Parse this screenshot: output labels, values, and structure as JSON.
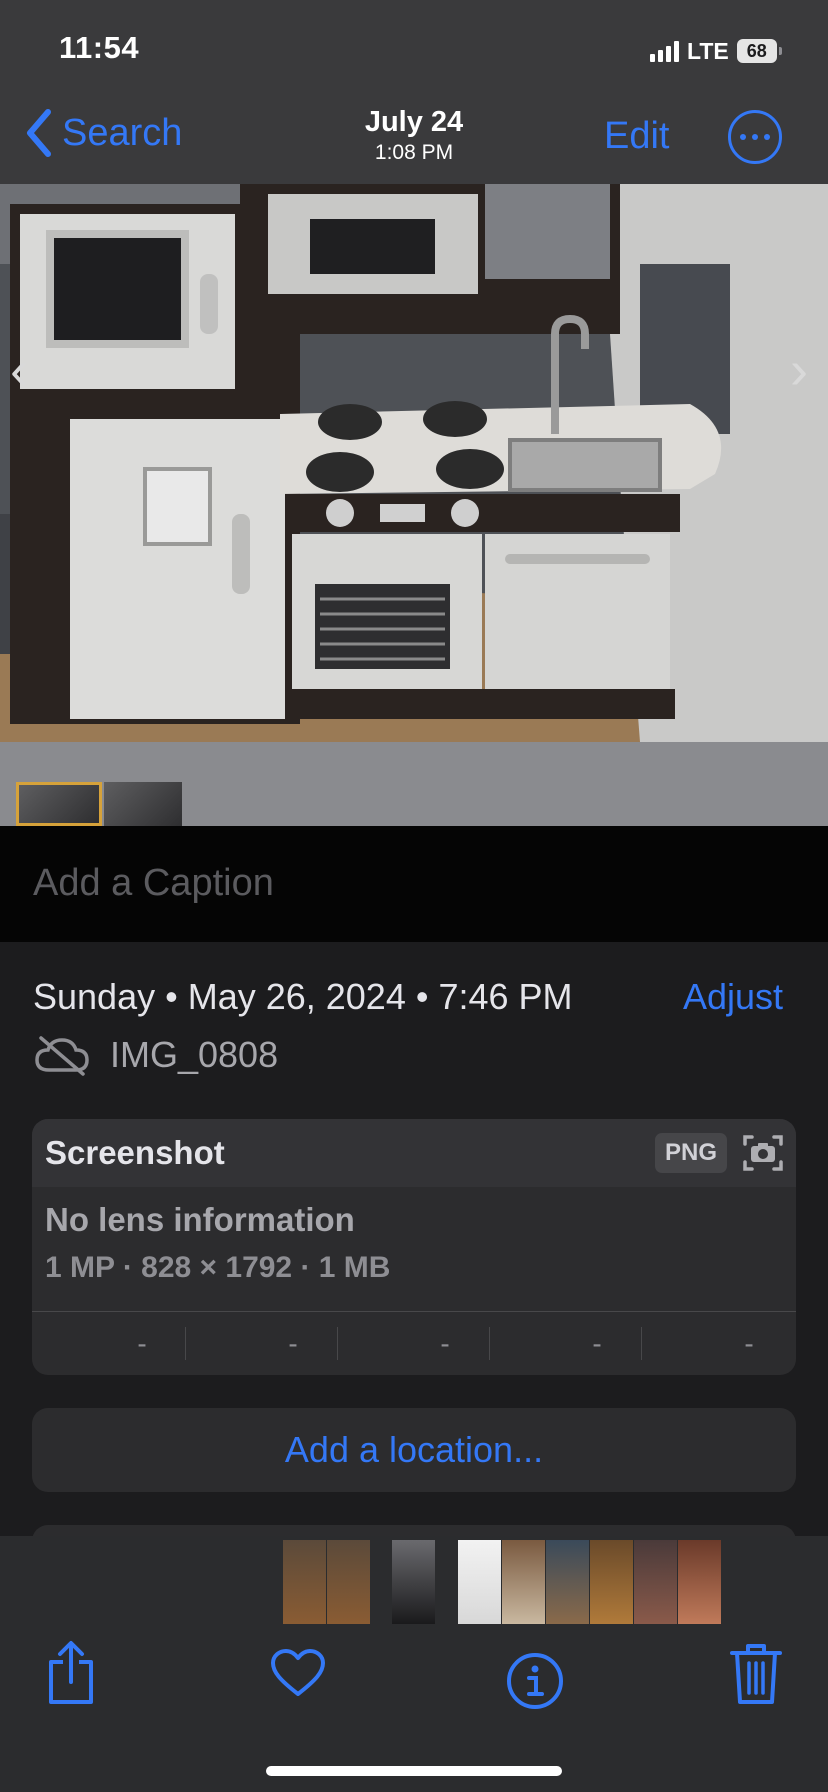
{
  "status": {
    "time": "11:54",
    "network": "LTE",
    "battery": "68"
  },
  "nav": {
    "back_label": "Search",
    "date": "July 24",
    "time": "1:08 PM",
    "edit_label": "Edit"
  },
  "caption": {
    "placeholder": "Add a Caption"
  },
  "info": {
    "datetime": "Sunday • May 26, 2024 • 7:46 PM",
    "adjust_label": "Adjust",
    "filename": "IMG_0808",
    "card": {
      "title": "Screenshot",
      "format": "PNG",
      "lens": "No lens information",
      "specs": "1 MP  ·  828 × 1792  ·  1 MB",
      "exif": [
        "-",
        "-",
        "-",
        "-",
        "-"
      ]
    },
    "location_label": "Add a location..."
  },
  "colors": {
    "accent": "#3478f6",
    "background": "#1c1c1e",
    "card": "#2c2c2e"
  },
  "toolbar": {
    "icons": [
      "share-icon",
      "heart-icon",
      "info-icon",
      "trash-icon"
    ]
  }
}
